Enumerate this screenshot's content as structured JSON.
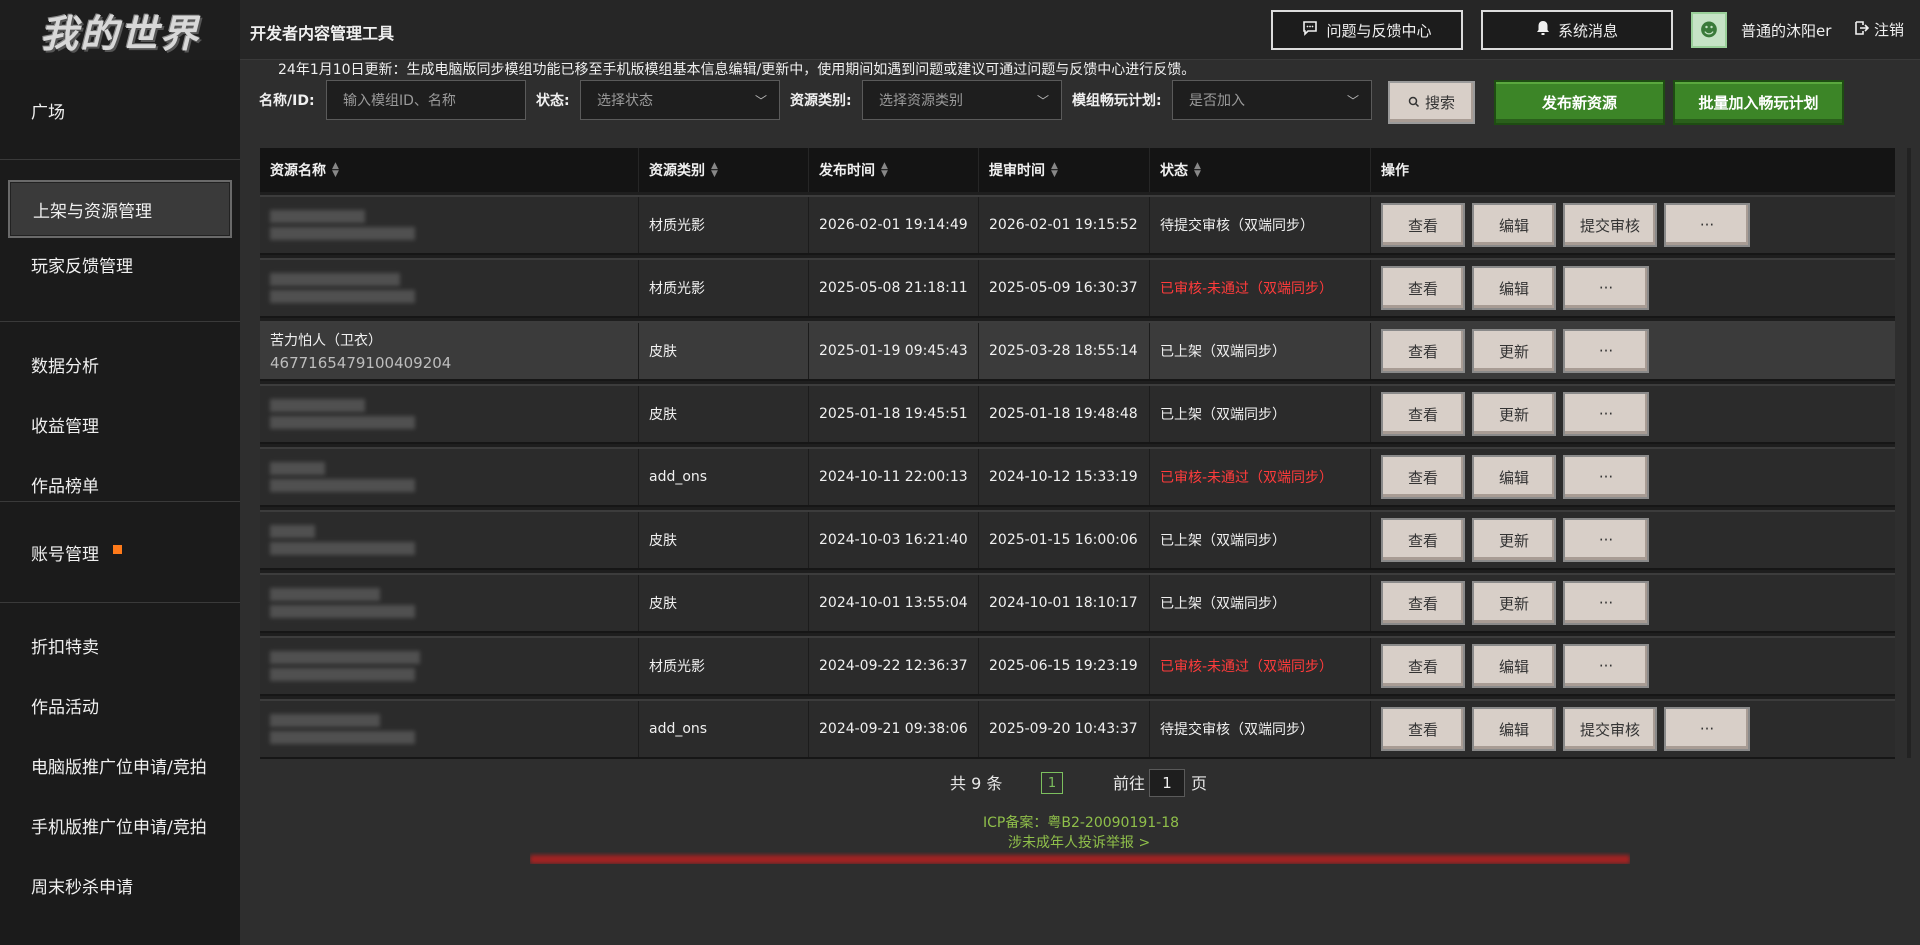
{
  "header": {
    "logo_text": "我的世界",
    "app_title": "开发者内容管理工具",
    "feedback_label": "问题与反馈中心",
    "messages_label": "系统消息",
    "username": "普通的沐阳er",
    "logout_label": "注销"
  },
  "sidebar": {
    "groups": [
      [
        "广场"
      ],
      [
        "上架与资源管理",
        "玩家反馈管理"
      ],
      [
        "数据分析",
        "收益管理",
        "作品榜单"
      ],
      [
        "账号管理"
      ],
      [
        "折扣特卖",
        "作品活动",
        "电脑版推广位申请/竞拍",
        "手机版推广位申请/竞拍",
        "周末秒杀申请"
      ]
    ],
    "active": "上架与资源管理"
  },
  "notice": "24年1月10日更新：生成电脑版同步模组功能已移至手机版模组基本信息编辑/更新中，使用期间如遇到问题或建议可通过问题与反馈中心进行反馈。",
  "filters": {
    "name_label": "名称/ID:",
    "name_placeholder": "输入模组ID、名称",
    "status_label": "状态:",
    "status_placeholder": "选择状态",
    "type_label": "资源类别:",
    "type_placeholder": "选择资源类别",
    "plan_label": "模组畅玩计划:",
    "plan_placeholder": "是否加入",
    "search_label": "搜索",
    "publish_label": "发布新资源",
    "batch_label": "批量加入畅玩计划"
  },
  "table": {
    "headers": [
      "资源名称",
      "资源类别",
      "发布时间",
      "提审时间",
      "状态",
      "操作"
    ],
    "rows": [
      {
        "name": "",
        "id": "",
        "type": "材质光影",
        "publish": "2026-02-01 19:14:49",
        "submit": "2026-02-01 19:15:52",
        "status": "待提交审核（双端同步）",
        "status_color": "#f0f0f0",
        "actions": [
          "查看",
          "编辑",
          "提交审核",
          "···"
        ]
      },
      {
        "name": "",
        "id": "",
        "type": "材质光影",
        "publish": "2025-05-08 21:18:11",
        "submit": "2025-05-09 16:30:37",
        "status": "已审核-未通过（双端同步）",
        "status_color": "#ff3b3b",
        "actions": [
          "查看",
          "编辑",
          "···"
        ]
      },
      {
        "name": "苦力怕人（卫衣）",
        "id": "4677165479100409204",
        "type": "皮肤",
        "publish": "2025-01-19 09:45:43",
        "submit": "2025-03-28 18:55:14",
        "status": "已上架（双端同步）",
        "status_color": "#f0f0f0",
        "actions": [
          "查看",
          "更新",
          "···"
        ]
      },
      {
        "name": "",
        "id": "",
        "type": "皮肤",
        "publish": "2025-01-18 19:45:51",
        "submit": "2025-01-18 19:48:48",
        "status": "已上架（双端同步）",
        "status_color": "#f0f0f0",
        "actions": [
          "查看",
          "更新",
          "···"
        ]
      },
      {
        "name": "",
        "id": "",
        "type": "add_ons",
        "publish": "2024-10-11 22:00:13",
        "submit": "2024-10-12 15:33:19",
        "status": "已审核-未通过（双端同步）",
        "status_color": "#ff3b3b",
        "actions": [
          "查看",
          "编辑",
          "···"
        ]
      },
      {
        "name": "",
        "id": "",
        "type": "皮肤",
        "publish": "2024-10-03 16:21:40",
        "submit": "2025-01-15 16:00:06",
        "status": "已上架（双端同步）",
        "status_color": "#f0f0f0",
        "actions": [
          "查看",
          "更新",
          "···"
        ]
      },
      {
        "name": "",
        "id": "",
        "type": "皮肤",
        "publish": "2024-10-01 13:55:04",
        "submit": "2024-10-01 18:10:17",
        "status": "已上架（双端同步）",
        "status_color": "#f0f0f0",
        "actions": [
          "查看",
          "更新",
          "···"
        ]
      },
      {
        "name": "",
        "id": "",
        "type": "材质光影",
        "publish": "2024-09-22 12:36:37",
        "submit": "2025-06-15 19:23:19",
        "status": "已审核-未通过（双端同步）",
        "status_color": "#ff3b3b",
        "actions": [
          "查看",
          "编辑",
          "···"
        ]
      },
      {
        "name": "",
        "id": "",
        "type": "add_ons",
        "publish": "2024-09-21 09:38:06",
        "submit": "2025-09-20 10:43:37",
        "status": "待提交审核（双端同步）",
        "status_color": "#f0f0f0",
        "actions": [
          "查看",
          "编辑",
          "提交审核",
          "···"
        ]
      }
    ]
  },
  "pagination": {
    "total": "共 9 条",
    "current_page": "1",
    "goto_label": "前往",
    "goto_value": "1",
    "page_suffix": "页"
  },
  "footer": {
    "icp": "ICP备案：粤B2-20090191-18",
    "report": "涉未成年人投诉举报 >"
  }
}
